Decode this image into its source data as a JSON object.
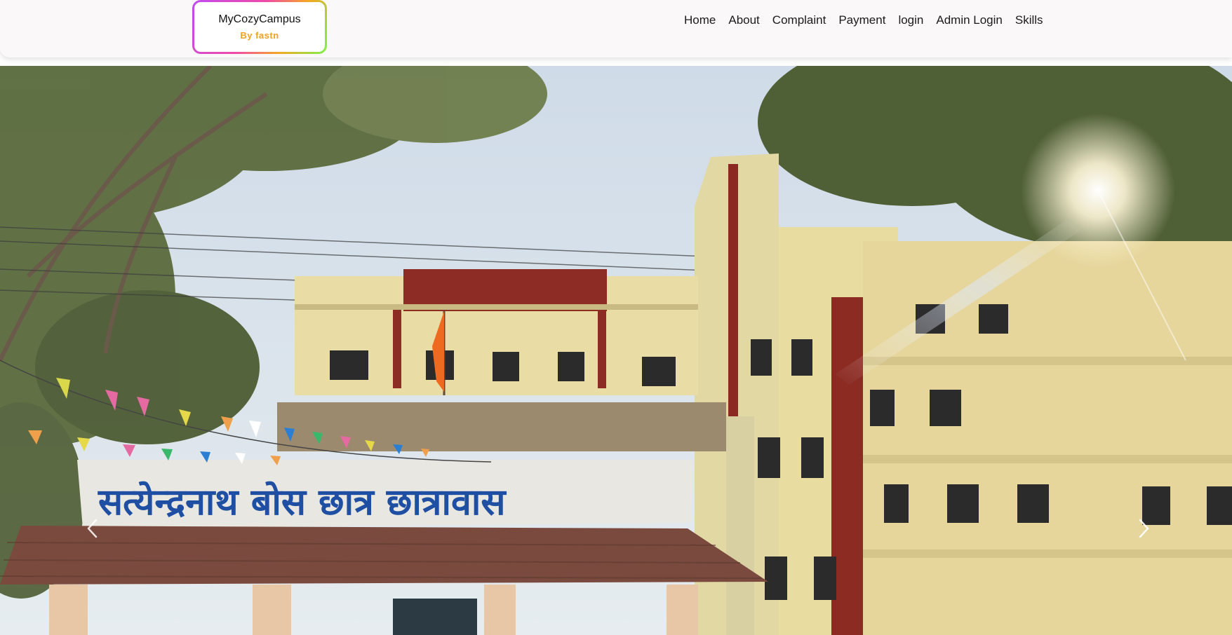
{
  "brand": {
    "title": "MyCozyCampus",
    "subtitle": "By fastn"
  },
  "nav": {
    "items": [
      {
        "label": "Home"
      },
      {
        "label": "About"
      },
      {
        "label": "Complaint"
      },
      {
        "label": "Payment"
      },
      {
        "label": "login"
      },
      {
        "label": "Admin Login"
      },
      {
        "label": "Skills"
      }
    ]
  },
  "carousel": {
    "signboard_text": "सत्येन्द्रनाथ बोस छात्र छात्रावास",
    "prev_icon": "chevron-left-icon",
    "next_icon": "chevron-right-icon"
  },
  "colors": {
    "navbar_bg": "#faf8f9",
    "brand_subtitle": "#f0a21c",
    "building_wall": "#e9dca0",
    "building_accent": "#8a2a22",
    "signboard_text": "#1f4fa3"
  }
}
